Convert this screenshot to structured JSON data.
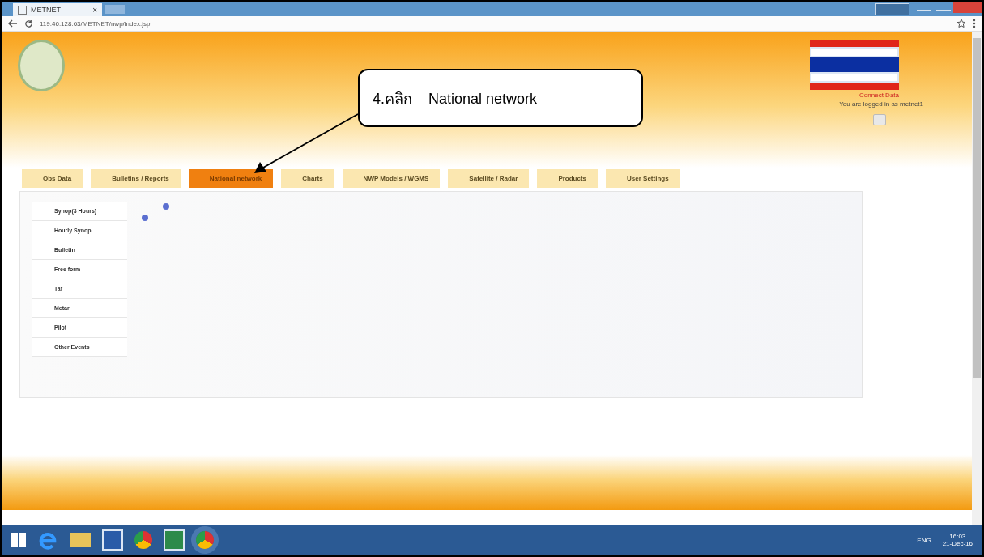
{
  "browser": {
    "tab_title": "METNET",
    "tab_close": "×",
    "address": "119.46.128.63/METNET/nwp/index.jsp"
  },
  "header": {
    "login_link": "Connect Data",
    "login_text": "You are logged in as metnet1"
  },
  "callout": {
    "text": "4.คลิก    National network"
  },
  "menu": [
    {
      "label": "Obs Data",
      "selected": false
    },
    {
      "label": "Bulletins / Reports",
      "selected": false
    },
    {
      "label": "National network",
      "selected": true
    },
    {
      "label": "Charts",
      "selected": false
    },
    {
      "label": "NWP Models / WGMS",
      "selected": false
    },
    {
      "label": "Satellite / Radar",
      "selected": false
    },
    {
      "label": "Products",
      "selected": false
    },
    {
      "label": "User Settings",
      "selected": false
    }
  ],
  "submenu": [
    {
      "label": "Synop(3 Hours)"
    },
    {
      "label": "Hourly Synop"
    },
    {
      "label": "Bulletin"
    },
    {
      "label": "Free form"
    },
    {
      "label": "Taf"
    },
    {
      "label": "Metar"
    },
    {
      "label": "Pilot"
    },
    {
      "label": "Other Events"
    }
  ],
  "taskbar": {
    "language": "ENG",
    "time": "16:03",
    "date": "21-Dec-16"
  }
}
